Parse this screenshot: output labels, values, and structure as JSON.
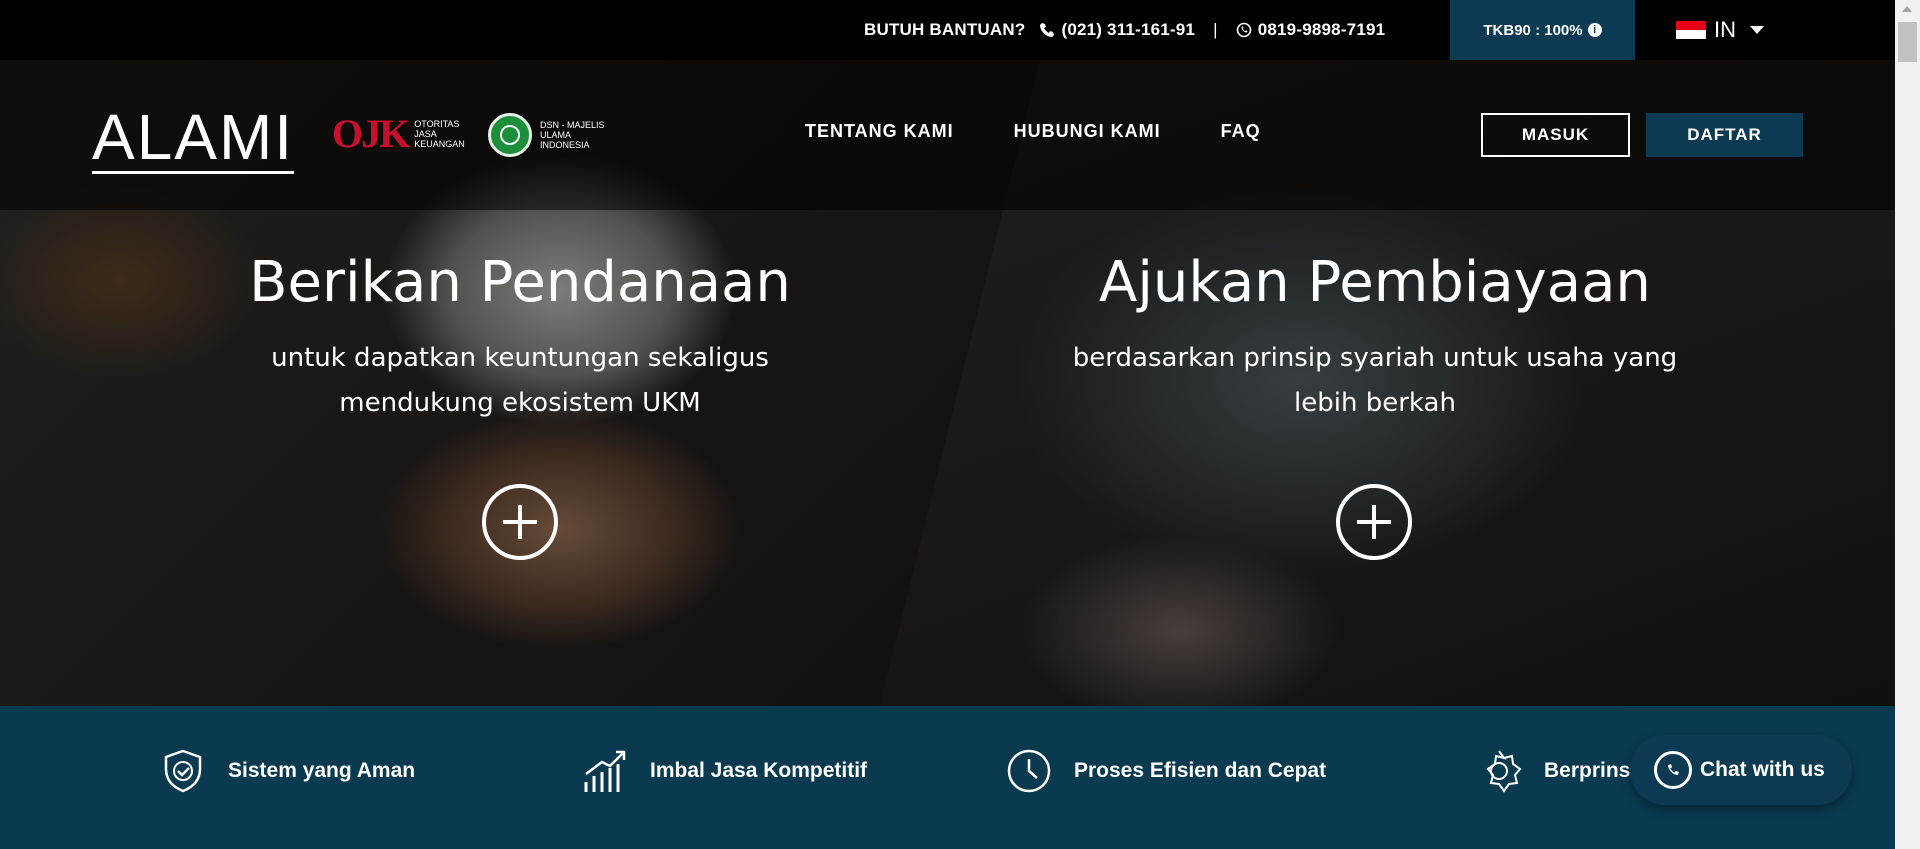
{
  "topbar": {
    "help_label": "BUTUH BANTUAN?",
    "phone": "(021) 311-161-91",
    "separator": "|",
    "whatsapp": "0819-9898-7191",
    "tkb_label": "TKB90 : 100%",
    "language": "IN"
  },
  "brand": {
    "logo": "ALAMI",
    "ojk_mark": "OJK",
    "ojk_text": "OTORITAS JASA KEUANGAN",
    "dsn_text": "DSN - MAJELIS ULAMA INDONESIA"
  },
  "nav": {
    "items": [
      {
        "label": "TENTANG KAMI"
      },
      {
        "label": "HUBUNGI KAMI"
      },
      {
        "label": "FAQ"
      }
    ],
    "login_label": "MASUK",
    "register_label": "DAFTAR"
  },
  "hero": {
    "left": {
      "title": "Berikan Pendanaan",
      "subtitle": "untuk dapatkan keuntungan sekaligus mendukung ekosistem UKM"
    },
    "right": {
      "title": "Ajukan Pembiayaan",
      "subtitle": "berdasarkan prinsip syariah untuk usaha yang lebih berkah"
    }
  },
  "features": [
    {
      "label": "Sistem yang Aman",
      "icon": "shield-check-icon"
    },
    {
      "label": "Imbal Jasa Kompetitif",
      "icon": "growth-chart-icon"
    },
    {
      "label": "Proses Efisien dan Cepat",
      "icon": "clock-icon"
    },
    {
      "label": "Berprins",
      "icon": "star-badge-icon"
    }
  ],
  "chat": {
    "label": "Chat with us"
  },
  "colors": {
    "brand_dark": "#0b3a52",
    "ojk_red": "#c8102e"
  }
}
